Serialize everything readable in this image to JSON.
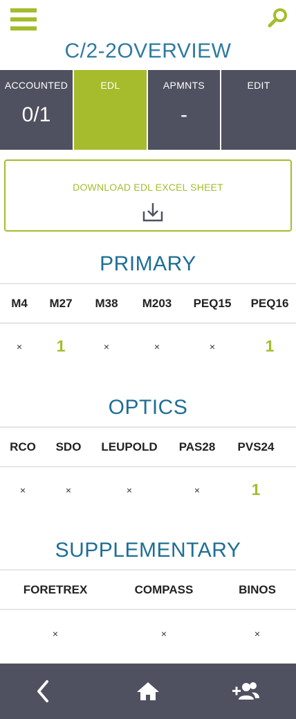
{
  "header": {
    "title": "C/2-2OVERVIEW",
    "menu_icon": "hamburger-menu-icon",
    "search_icon": "search-icon",
    "accent_color": "#a6bc2c",
    "title_color": "#2e7aa0"
  },
  "tabs": [
    {
      "label": "ACCOUNTED",
      "value": "0/1",
      "active": false
    },
    {
      "label": "EDL",
      "value": "",
      "active": true
    },
    {
      "label": "APMNTS",
      "value": "-",
      "active": false
    },
    {
      "label": "EDIT",
      "value": "",
      "active": false
    }
  ],
  "download": {
    "label": "DOWNLOAD EDL EXCEL SHEET",
    "icon": "download-icon"
  },
  "sections": {
    "primary": {
      "title": "PRIMARY",
      "columns": [
        "M4",
        "M27",
        "M38",
        "M203",
        "PEQ15",
        "PEQ16"
      ],
      "values": [
        "×",
        "1",
        "×",
        "×",
        "×",
        "1"
      ]
    },
    "optics": {
      "title": "OPTICS",
      "columns": [
        "RCO",
        "SDO",
        "LEUPOLD",
        "PAS28",
        "PVS24"
      ],
      "values": [
        "×",
        "×",
        "×",
        "×",
        "1"
      ]
    },
    "supplementary": {
      "title": "SUPPLEMENTARY",
      "columns": [
        "FORETREX",
        "COMPASS",
        "BINOS"
      ],
      "values": [
        "×",
        "×",
        "×"
      ]
    }
  },
  "bottom_nav": {
    "icons": [
      "back-chevron-icon",
      "home-icon",
      "add-people-icon"
    ],
    "bg_color": "#4f5160"
  }
}
